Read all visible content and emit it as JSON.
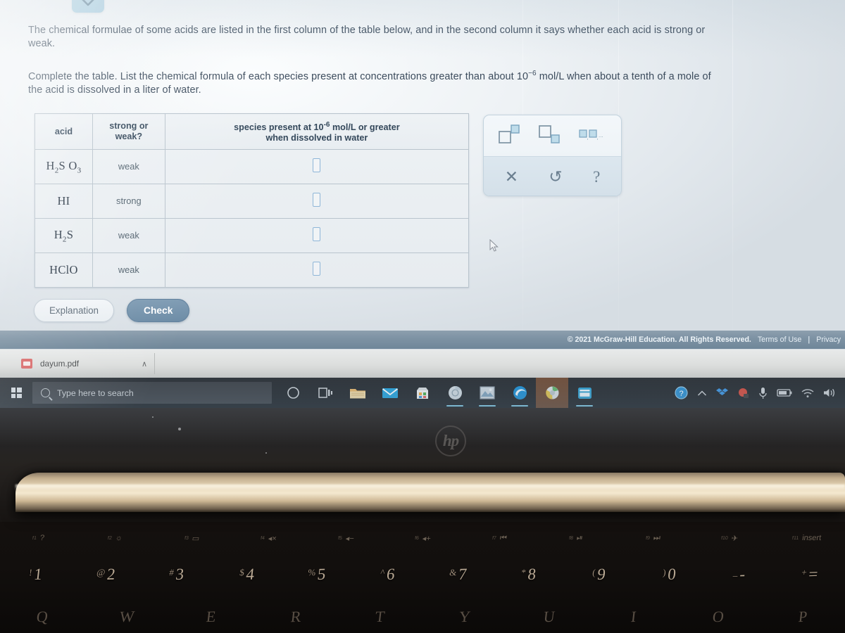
{
  "prompt": {
    "paragraph1_a": "The chemical formulae of some acids are listed in the first column of the table below, and in the second column it says whether each acid is strong or",
    "paragraph1_b": "weak.",
    "paragraph2_a": "Complete the table. List the chemical formula of each species present at concentrations greater than about 10",
    "paragraph2_exp": "−6",
    "paragraph2_b": " mol/L when about a tenth of a mole of",
    "paragraph2_c": "the acid is dissolved in a liter of water."
  },
  "table": {
    "headers": {
      "acid": "acid",
      "strength_line1": "strong or",
      "strength_line2": "weak?",
      "species_line1_a": "species present at 10",
      "species_line1_exp": "-6",
      "species_line1_b": " mol/L or greater",
      "species_line2": "when dissolved in water"
    },
    "rows": [
      {
        "formula_main1": "H",
        "sub1": "2",
        "formula_main2": "S O",
        "sub2": "3",
        "formula_plain": "H2SO3",
        "strength": "weak",
        "answer": ""
      },
      {
        "formula_main1": "HI",
        "sub1": "",
        "formula_main2": "",
        "sub2": "",
        "formula_plain": "HI",
        "strength": "strong",
        "answer": ""
      },
      {
        "formula_main1": "H",
        "sub1": "2",
        "formula_main2": "S",
        "sub2": "",
        "formula_plain": "H2S",
        "strength": "weak",
        "answer": ""
      },
      {
        "formula_main1": "HClO",
        "sub1": "",
        "formula_main2": "",
        "sub2": "",
        "formula_plain": "HClO",
        "strength": "weak",
        "answer": ""
      }
    ]
  },
  "tool_palette": {
    "superscript_icon": "superscript-icon",
    "subscript_icon": "subscript-icon",
    "list_icon": "comma-list-icon",
    "clear_glyph": "✕",
    "undo_glyph": "↺",
    "help_glyph": "?"
  },
  "actions": {
    "explanation_label": "Explanation",
    "check_label": "Check"
  },
  "footer": {
    "copyright": "© 2021 McGraw-Hill Education. All Rights Reserved.",
    "terms": "Terms of Use",
    "separator": "|",
    "privacy": "Privacy"
  },
  "download_bar": {
    "file_name": "dayum.pdf",
    "caret": "∧"
  },
  "taskbar": {
    "search_placeholder": "Type here to search",
    "start_icon": "windows-logo-icon",
    "search_icon": "search-icon",
    "pinned": [
      "cortana-circle-icon",
      "task-view-icon",
      "file-explorer-icon",
      "mail-icon",
      "microsoft-store-icon",
      "chrome-icon",
      "photos-icon",
      "edge-icon",
      "browser-active-icon",
      "app-window-icon"
    ],
    "tray": [
      "help-circle-icon",
      "chevron-up-icon",
      "dropbox-icon",
      "red-app-icon",
      "microphone-icon",
      "battery-icon",
      "wifi-icon",
      "volume-icon"
    ]
  },
  "laptop": {
    "brand_logo": "hp",
    "function_keys": [
      {
        "fn": "f1",
        "sym": "?"
      },
      {
        "fn": "f2",
        "sym": "☼"
      },
      {
        "fn": "f3",
        "sym": "▭"
      },
      {
        "fn": "f4",
        "sym": "◂×"
      },
      {
        "fn": "f5",
        "sym": "◂−"
      },
      {
        "fn": "f6",
        "sym": "◂+"
      },
      {
        "fn": "f7",
        "sym": "⏮"
      },
      {
        "fn": "f8",
        "sym": "⏯"
      },
      {
        "fn": "f9",
        "sym": "⏭"
      },
      {
        "fn": "f10",
        "sym": "✈"
      },
      {
        "fn": "f11",
        "sym": "insert"
      }
    ],
    "number_keys": [
      {
        "sym": "!",
        "dig": "1"
      },
      {
        "sym": "@",
        "dig": "2"
      },
      {
        "sym": "#",
        "dig": "3"
      },
      {
        "sym": "$",
        "dig": "4"
      },
      {
        "sym": "%",
        "dig": "5"
      },
      {
        "sym": "^",
        "dig": "6"
      },
      {
        "sym": "&",
        "dig": "7"
      },
      {
        "sym": "*",
        "dig": "8"
      },
      {
        "sym": "(",
        "dig": "9"
      },
      {
        "sym": ")",
        "dig": "0"
      },
      {
        "sym": "_",
        "dig": "-"
      },
      {
        "sym": "+",
        "dig": "="
      }
    ],
    "letter_keys": [
      "Q",
      "W",
      "E",
      "R",
      "T",
      "Y",
      "U",
      "I",
      "O",
      "P"
    ]
  }
}
